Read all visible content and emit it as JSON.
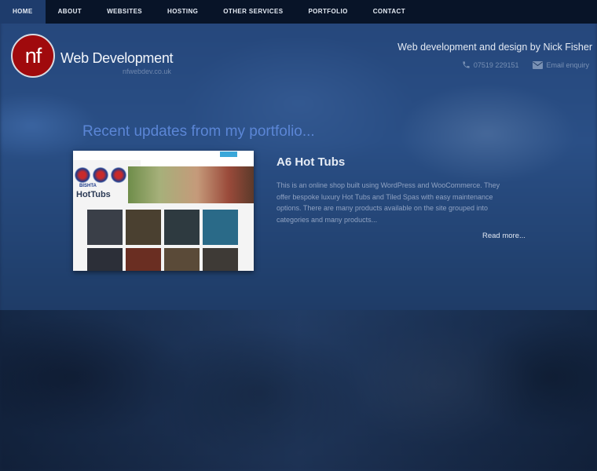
{
  "nav": {
    "items": [
      {
        "label": "HOME",
        "active": true
      },
      {
        "label": "ABOUT"
      },
      {
        "label": "WEBSITES"
      },
      {
        "label": "HOSTING"
      },
      {
        "label": "OTHER SERVICES"
      },
      {
        "label": "PORTFOLIO"
      },
      {
        "label": "CONTACT"
      }
    ]
  },
  "header": {
    "logo_mark": "nf",
    "logo_title": "Web Development",
    "logo_sub": "nfwebdev.co.uk",
    "tagline": "Web development and design by Nick Fisher",
    "phone": "07519 229151",
    "email_label": "Email enquiry",
    "phone_icon": "phone-icon",
    "email_icon": "envelope-icon"
  },
  "portfolio": {
    "section_title": "Recent updates from my portfolio...",
    "post_title": "A6 Hot Tubs",
    "post_text": "This is an online shop built using WordPress and WooCommerce. They offer bespoke luxury Hot Tubs and Tiled Spas with easy maintenance options. There are many products available on the site grouped into categories and many products...",
    "read_more": "Read more...",
    "thumb_brand": "HotTubs",
    "thumb_brand_small": "BISHTA"
  },
  "colors": {
    "logo_red": "#a00a0d",
    "nav_bg": "#081428",
    "nav_active": "#1e3c6c",
    "accent_blue": "#5b86d6"
  }
}
